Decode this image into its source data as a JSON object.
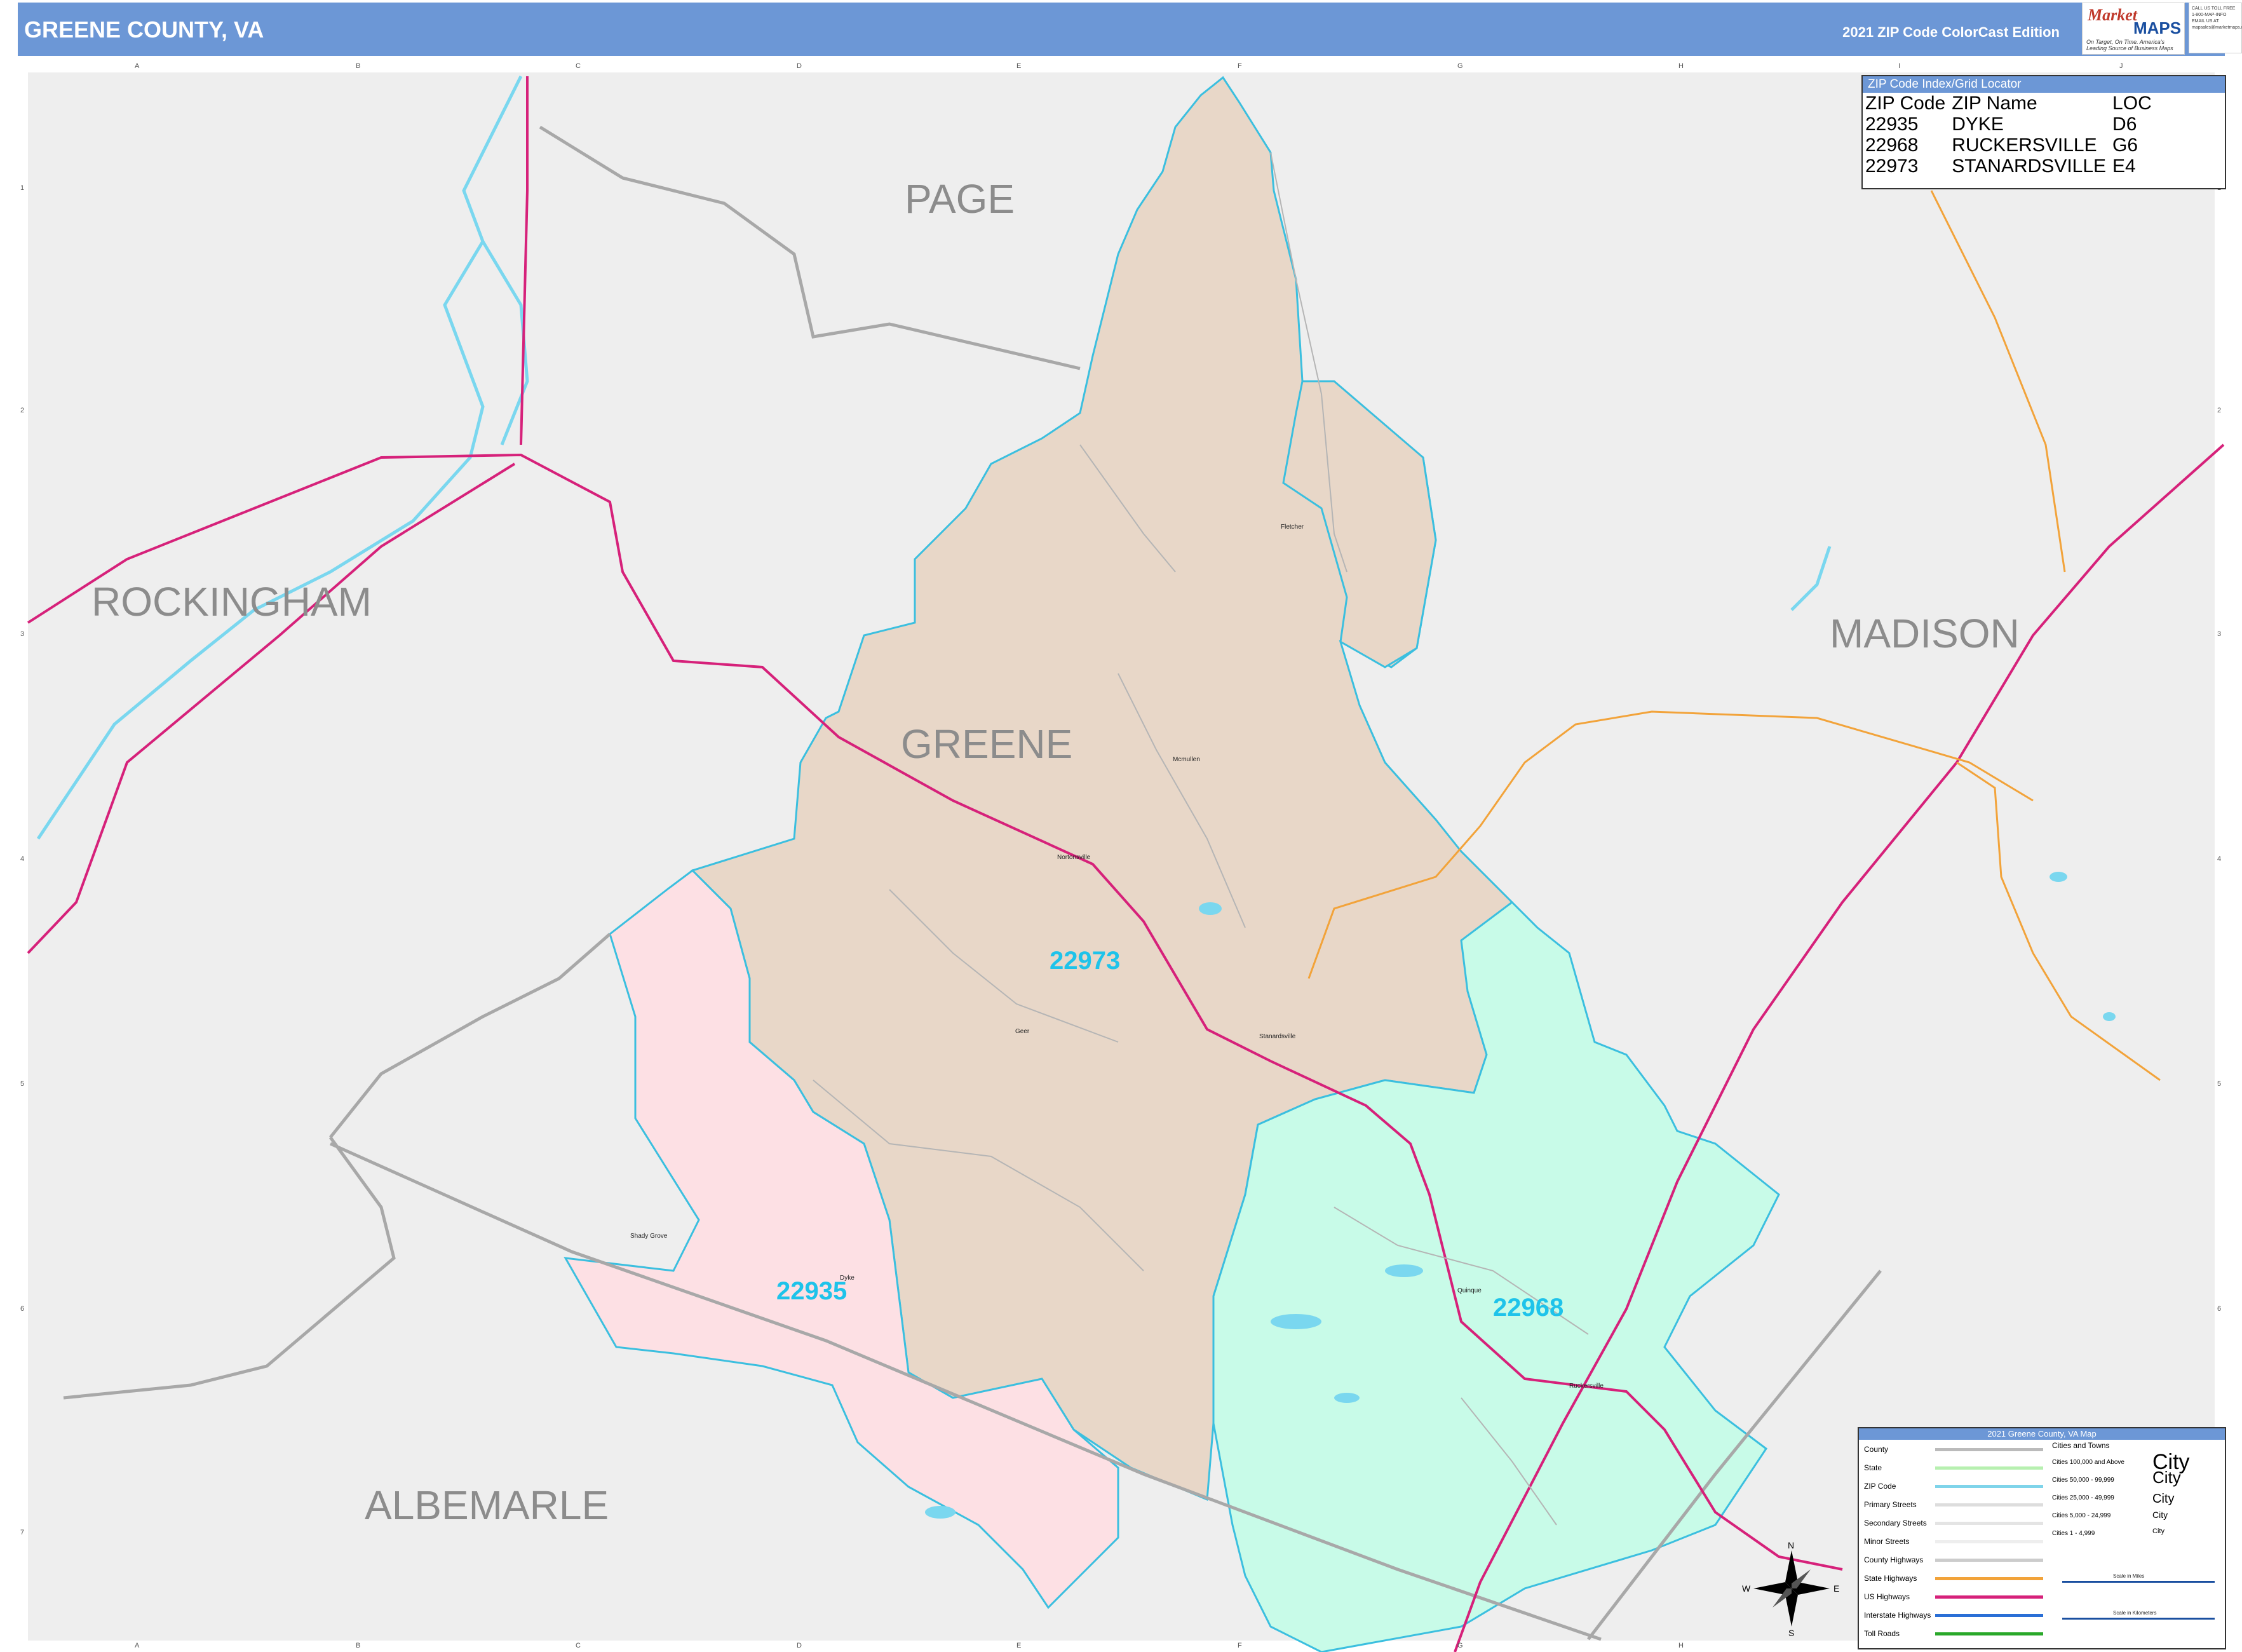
{
  "header": {
    "title": "GREENE COUNTY, VA",
    "edition": "2021 ZIP Code ColorCast Edition"
  },
  "logo": {
    "line1": "Market",
    "line2": "MAPS",
    "tagline": "On Target, On Time. America's Leading Source of Business Maps"
  },
  "contact": {
    "text": "CALL US TOLL FREE 1-800-MAP-INFO EMAIL US AT: mapsales@marketmaps.com"
  },
  "grid": {
    "columns": [
      "A",
      "B",
      "C",
      "D",
      "E",
      "F",
      "G",
      "H",
      "I",
      "J"
    ],
    "rows": [
      "1",
      "2",
      "3",
      "4",
      "5",
      "6",
      "7"
    ]
  },
  "counties": {
    "page": "PAGE",
    "rockingham": "ROCKINGHAM",
    "greene": "GREENE",
    "madison": "MADISON",
    "albemarle": "ALBEMARLE"
  },
  "zips": [
    {
      "code": "22973",
      "color": "#e8d7c8"
    },
    {
      "code": "22935",
      "color": "#fde0e4"
    },
    {
      "code": "22968",
      "color": "#c8fbe8"
    }
  ],
  "towns": {
    "fletcher": "Fletcher",
    "mcmullen": "Mcmullen",
    "stanardsville": "Stanardsville",
    "ruckersville": "Ruckersville",
    "dyke": "Dyke",
    "shady_grove": "Shady Grove",
    "quinque": "Quinque",
    "geer": "Geer",
    "nortonsville": "Nortonsville"
  },
  "zip_index": {
    "heading": "ZIP Code Index/Grid Locator",
    "columns": [
      "ZIP Code",
      "ZIP Name",
      "LOC"
    ],
    "rows": [
      [
        "22935",
        "DYKE",
        "D6"
      ],
      [
        "22968",
        "RUCKERSVILLE",
        "G6"
      ],
      [
        "22973",
        "STANARDSVILLE",
        "E4"
      ]
    ]
  },
  "legend": {
    "heading": "2021 Greene County, VA Map",
    "items": [
      {
        "label": "County",
        "color": "#bbbbbb"
      },
      {
        "label": "State",
        "color": "#b7f0b0"
      },
      {
        "label": "ZIP Code",
        "color": "#7fd4ea"
      },
      {
        "label": "Primary Streets",
        "color": "#dddddd"
      },
      {
        "label": "Secondary Streets",
        "color": "#e4e4e4"
      },
      {
        "label": "Minor Streets",
        "color": "#eeeeee"
      },
      {
        "label": "County Highways",
        "color": "#cccccc"
      },
      {
        "label": "State Highways",
        "color": "#f2a33a"
      },
      {
        "label": "US Highways",
        "color": "#d6217a"
      },
      {
        "label": "Interstate Highways",
        "color": "#2a6fd6"
      },
      {
        "label": "Toll Roads",
        "color": "#2aa82a"
      }
    ],
    "cities_heading": "Cities and Towns",
    "cities": [
      {
        "label": "Cities 100,000 and Above",
        "sample": "City"
      },
      {
        "label": "Cities 50,000 - 99,999",
        "sample": "City"
      },
      {
        "label": "Cities 25,000 - 49,999",
        "sample": "City"
      },
      {
        "label": "Cities 5,000 - 24,999",
        "sample": "City"
      },
      {
        "label": "Cities 1 - 4,999",
        "sample": "City"
      }
    ],
    "scale_miles": "Scale in Miles",
    "scale_km": "Scale in Kilometers"
  },
  "compass": {
    "n": "N",
    "s": "S",
    "e": "E",
    "w": "W"
  }
}
